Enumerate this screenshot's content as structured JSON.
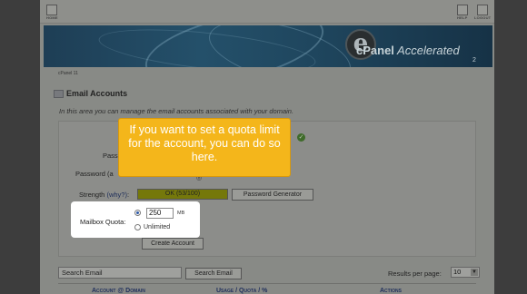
{
  "topbar": {
    "home_label": "HOME",
    "help_label": "HELP",
    "logout_label": "LOGOUT"
  },
  "banner": {
    "logo_letter": "e",
    "brand_a": "cPanel",
    "brand_b": " Accelerated",
    "brand_version": "2"
  },
  "breadcrumb": "cPanel 11",
  "section": {
    "title": "Email Accounts",
    "description": "In this area you can manage the email accounts associated with your domain."
  },
  "form": {
    "password_label_partial": "Pass",
    "password_again_partial": "Password (a",
    "strength_label": "Strength",
    "strength_why": "(why?)",
    "strength_value": "OK (53/100)",
    "password_generator_button": "Password Generator",
    "mailbox_quota_label": "Mailbox Quota:",
    "quota_value": "250",
    "quota_unit": "MB",
    "unlimited_label": "Unlimited",
    "create_button": "Create Account"
  },
  "search": {
    "input_value": "Search Email",
    "button_label": "Search Email"
  },
  "pagination": {
    "results_label": "Results per page:",
    "results_value": "10"
  },
  "table": {
    "col_account": "Account @ Domain",
    "col_usage": "Usage / Quota / %",
    "col_actions": "Actions"
  },
  "tooltip": {
    "text": "If you want to set a quota limit for the account, you can do so here."
  },
  "colors": {
    "tooltip_bg": "#f4b61b",
    "overlay": "#3d3d3d"
  }
}
